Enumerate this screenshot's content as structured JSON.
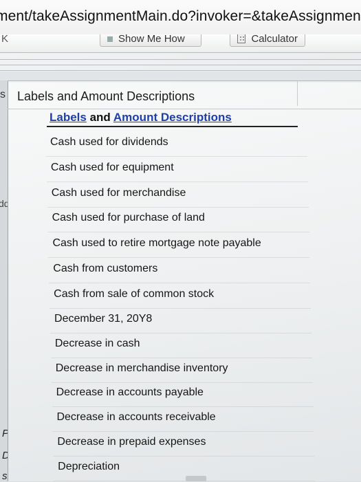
{
  "browser": {
    "url_fragment": "ment/takeAssignmentMain.do?invoker=&takeAssignmentSe"
  },
  "toolbar": {
    "partial_left": "K",
    "show_me_how": "Show Me How",
    "calculator": "Calculator"
  },
  "sidebar": {
    "partial_s": "s",
    "partial_dd": "dd",
    "partial_pre": "Pre",
    "partial_des": "Des",
    "partial_sign": "sign"
  },
  "panel": {
    "title": "Labels and Amount Descriptions",
    "header_labels": "Labels",
    "header_and": " and ",
    "header_amounts": "Amount Descriptions",
    "items": [
      "Cash used for dividends",
      "Cash used for equipment",
      "Cash used for merchandise",
      "Cash used for purchase of land",
      "Cash used to retire mortgage note payable",
      "Cash from customers",
      "Cash from sale of common stock",
      "December 31, 20Y8",
      "Decrease in cash",
      "Decrease in merchandise inventory",
      "Decrease in accounts payable",
      "Decrease in accounts receivable",
      "Decrease in prepaid expenses",
      "Depreciation"
    ]
  },
  "colors": {
    "link": "#1f3fa8",
    "text": "#161616",
    "background": "#eef0f1"
  }
}
